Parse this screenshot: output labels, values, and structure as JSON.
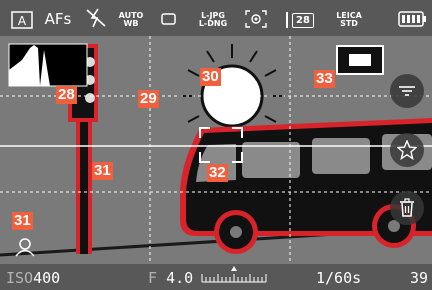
{
  "top_bar": {
    "auto_wb_line1": "AUTO",
    "auto_wb_line2": "WB",
    "af_label": "AFs",
    "format_line1": "L-JPG",
    "format_line2": "L-DNG",
    "shots_label": "28",
    "film_line1": "LEICA",
    "film_line2": "STD"
  },
  "bottom_bar": {
    "iso_prefix": "ISO",
    "iso_value": "400",
    "aperture_prefix": "F",
    "aperture_value": "4.0",
    "shutter_value": "1/60s",
    "remaining_shots": "39"
  },
  "markers": {
    "m28": "28",
    "m29": "29",
    "m30": "30",
    "m31_pole": "31",
    "m31_corner": "31",
    "m32": "32",
    "m33": "33"
  },
  "colors": {
    "marker": "#f1603e",
    "focus_peaking": "#d9232b",
    "overlay_icon": "#ffffff"
  },
  "icons": {
    "top": [
      "mode-a-icon",
      "flash-off-icon",
      "single-frame-icon",
      "spot-metering-icon",
      "battery-icon"
    ],
    "side": [
      "filter-menu-icon",
      "star-icon",
      "trash-icon"
    ],
    "bottom": [
      "exposure-scale-icon"
    ],
    "corner": [
      "face-detection-icon"
    ]
  }
}
